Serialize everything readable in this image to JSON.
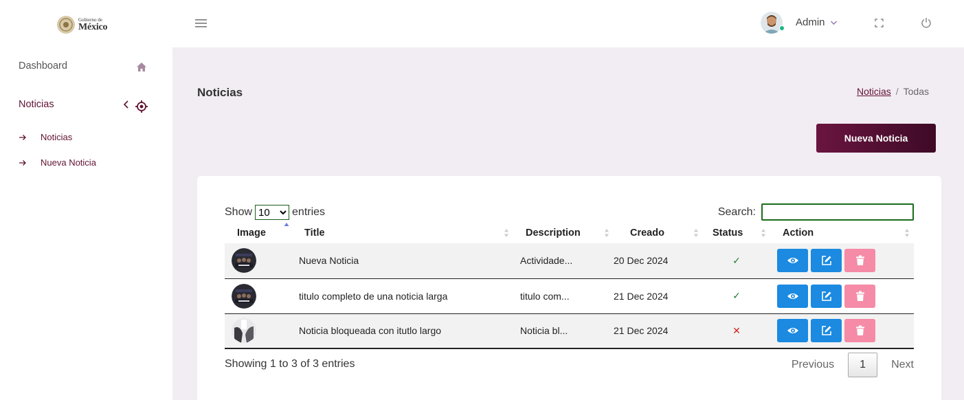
{
  "logo": {
    "line1": "Gobierno de",
    "line2": "México"
  },
  "sidebar": {
    "dashboard": "Dashboard",
    "noticias": "Noticias",
    "sub_items": [
      "Noticias",
      "Nueva Noticia"
    ]
  },
  "topbar": {
    "user": "Admin"
  },
  "page": {
    "title": "Noticias",
    "breadcrumb_link": "Noticias",
    "breadcrumb_sep": "/",
    "breadcrumb_current": "Todas",
    "new_button": "Nueva Noticia"
  },
  "table_controls": {
    "show_label": "Show",
    "entries_label": "entries",
    "page_length": "10",
    "search_label": "Search:"
  },
  "table": {
    "headers": [
      "Image",
      "Title",
      "Description",
      "Creado",
      "Status",
      "Action"
    ],
    "rows": [
      {
        "title": "Nueva Noticia",
        "description": "Actividade...",
        "created": "20 Dec 2024",
        "status": "✓",
        "status_color": "#1e7b34"
      },
      {
        "title": "titulo completo de una noticia larga",
        "description": "titulo com...",
        "created": "21 Dec 2024",
        "status": "✓",
        "status_color": "#1e7b34"
      },
      {
        "title": "Noticia bloqueada con itutlo largo",
        "description": "Noticia bl...",
        "created": "21 Dec 2024",
        "status": "✕",
        "status_color": "#d02020"
      }
    ]
  },
  "footer": {
    "info": "Showing 1 to 3 of 3 entries",
    "previous": "Previous",
    "page": "1",
    "next": "Next"
  },
  "colors": {
    "brand": "#611232",
    "view_button": "#1b8ae0",
    "delete_button": "#f58ba6",
    "background": "#f2ecf3"
  }
}
